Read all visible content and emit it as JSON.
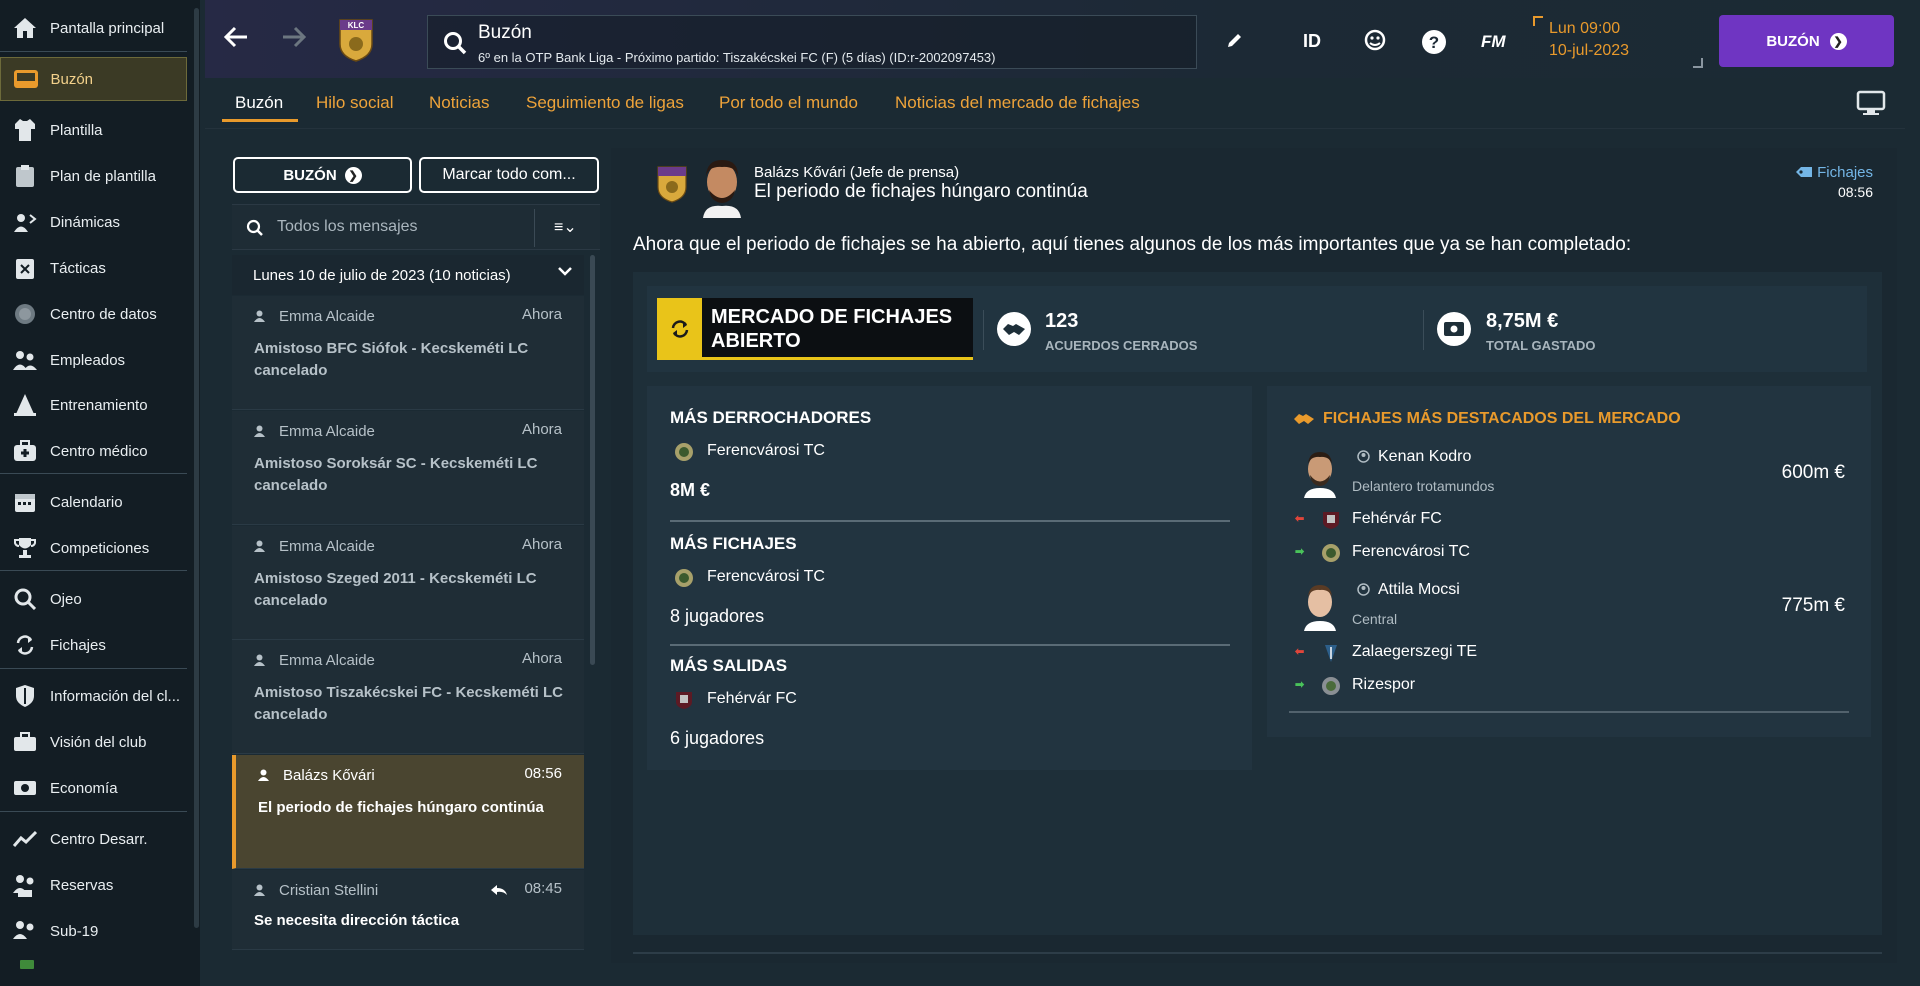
{
  "sidebar": {
    "items": [
      {
        "label": "Pantalla principal",
        "icon": "home-icon"
      },
      {
        "label": "Buzón",
        "icon": "inbox-icon"
      },
      {
        "label": "Plantilla",
        "icon": "shirt-icon"
      },
      {
        "label": "Plan de plantilla",
        "icon": "clipboard-icon"
      },
      {
        "label": "Dinámicas",
        "icon": "dynamics-icon"
      },
      {
        "label": "Tácticas",
        "icon": "tactics-board-icon"
      },
      {
        "label": "Centro de datos",
        "icon": "data-hub-icon"
      },
      {
        "label": "Empleados",
        "icon": "staff-icon"
      },
      {
        "label": "Entrenamiento",
        "icon": "training-cone-icon"
      },
      {
        "label": "Centro médico",
        "icon": "medical-kit-icon"
      },
      {
        "label": "Calendario",
        "icon": "calendar-icon"
      },
      {
        "label": "Competiciones",
        "icon": "trophy-icon"
      },
      {
        "label": "Ojeo",
        "icon": "magnifier-icon"
      },
      {
        "label": "Fichajes",
        "icon": "transfer-arrows-icon"
      },
      {
        "label": "Información del cl...",
        "icon": "club-shield-icon"
      },
      {
        "label": "Visión del club",
        "icon": "briefcase-icon"
      },
      {
        "label": "Economía",
        "icon": "money-icon"
      },
      {
        "label": "Centro Desarr.",
        "icon": "growth-chart-icon"
      },
      {
        "label": "Reservas",
        "icon": "reserves-icon"
      },
      {
        "label": "Sub-19",
        "icon": "u19-icon"
      }
    ]
  },
  "header": {
    "back_icon": "back-arrow-icon",
    "forward_icon": "forward-arrow-icon",
    "club_crest_text": "KLC",
    "title": "Buzón",
    "subtitle": "6º en la OTP Bank Liga - Próximo partido: Tiszakécskei FC (F) (5 días) (ID:r-2002097453)",
    "id_label": "ID",
    "fm_label": "FM",
    "date_line1": "Lun 09:00",
    "date_line2": "10-jul-2023",
    "continue_label": "BUZÓN"
  },
  "tabs": [
    "Buzón",
    "Hilo social",
    "Noticias",
    "Seguimiento de ligas",
    "Por todo el mundo",
    "Noticias del mercado de fichajes"
  ],
  "inbox": {
    "button_label": "BUZÓN",
    "mark_all_label": "Marcar todo com...",
    "search_placeholder": "Todos los mensajes",
    "date_group": "Lunes 10 de julio de 2023 (10 noticias)",
    "messages": [
      {
        "from": "Emma Alcaide",
        "time": "Ahora",
        "subject": "Amistoso BFC Siófok - Kecskeméti LC cancelado"
      },
      {
        "from": "Emma Alcaide",
        "time": "Ahora",
        "subject": "Amistoso Soroksár SC - Kecskeméti LC cancelado"
      },
      {
        "from": "Emma Alcaide",
        "time": "Ahora",
        "subject": "Amistoso Szeged 2011 - Kecskeméti LC cancelado"
      },
      {
        "from": "Emma Alcaide",
        "time": "Ahora",
        "subject": "Amistoso Tiszakécskei FC - Kecskeméti LC cancelado"
      },
      {
        "from": "Balázs Kővári",
        "time": "08:56",
        "subject": "El periodo de fichajes húngaro continúa"
      },
      {
        "from": "Cristian Stellini",
        "time": "08:45",
        "subject": "Se necesita dirección táctica"
      }
    ]
  },
  "message": {
    "sender": "Balázs Kővári  (Jefe de prensa)",
    "subject": "El periodo de fichajes húngaro continúa",
    "tag": "Fichajes",
    "time": "08:56",
    "intro": "Ahora que el periodo de fichajes se ha abierto, aquí tienes algunos de los más importantes que ya se han completado:",
    "market_status": "MERCADO DE FICHAJES ABIERTO",
    "deals_value": "123",
    "deals_label": "ACUERDOS CERRADOS",
    "spent_value": "8,75M €",
    "spent_label": "TOTAL GASTADO",
    "stats": {
      "spenders_title": "MÁS DERROCHADORES",
      "spenders_club": "Ferencvárosi TC",
      "spenders_value": "8M €",
      "signings_title": "MÁS FICHAJES",
      "signings_club": "Ferencvárosi TC",
      "signings_value": "8 jugadores",
      "departures_title": "MÁS SALIDAS",
      "departures_club": "Fehérvár FC",
      "departures_value": "6 jugadores"
    },
    "highlights": {
      "title": "FICHAJES MÁS DESTACADOS DEL MERCADO",
      "players": [
        {
          "name": "Kenan Kodro",
          "position": "Delantero trotamundos",
          "fee": "600m €",
          "from": "Fehérvár FC",
          "to": "Ferencvárosi TC"
        },
        {
          "name": "Attila Mocsi",
          "position": "Central",
          "fee": "775m €",
          "from": "Zalaegerszegi TE",
          "to": "Rizespor"
        }
      ]
    }
  },
  "colors": {
    "accent_orange": "#e99a2c",
    "continue_purple": "#6f35c2",
    "market_yellow": "#e9c419",
    "tag_blue": "#74b6e6"
  }
}
